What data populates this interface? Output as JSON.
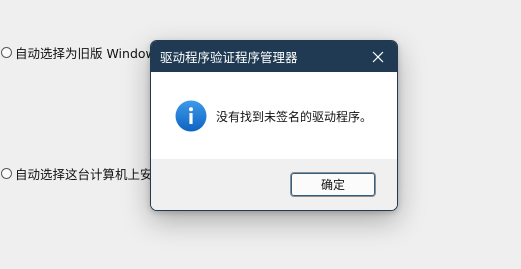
{
  "background": {
    "options": [
      {
        "label": "自动选择为旧版 Windows"
      },
      {
        "label": "自动选择这台计算机上安"
      }
    ]
  },
  "dialog": {
    "title": "驱动程序验证程序管理器",
    "message": "没有找到未签名的驱动程序。",
    "ok_label": "确定",
    "icon": "info-icon",
    "colors": {
      "titlebar": "#1f3a52",
      "icon": "#1976d2",
      "footer": "#f0f0f0"
    }
  }
}
